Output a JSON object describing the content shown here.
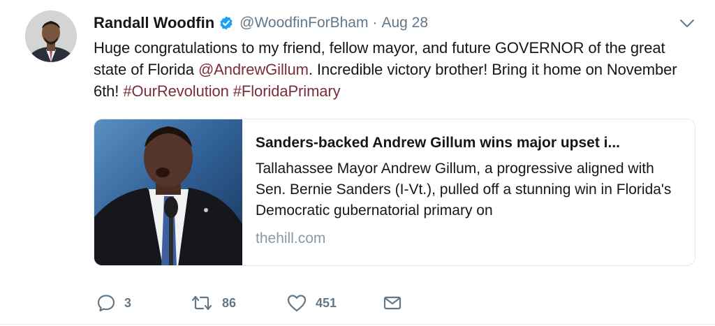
{
  "tweet": {
    "author_name": "Randall Woodfin",
    "author_handle": "@WoodfinForBham",
    "separator": "·",
    "date": "Aug 28",
    "text_parts": {
      "p1": "Huge congratulations to my friend, fellow mayor, and future GOVERNOR of the great state of Florida ",
      "mention": "@AndrewGillum",
      "p2": ". Incredible victory brother! Bring it home on November 6th! ",
      "hashtag1": "#OurRevolution",
      "space": " ",
      "hashtag2": "#FloridaPrimary"
    },
    "card": {
      "title": "Sanders-backed Andrew Gillum wins major upset i...",
      "description": "Tallahassee Mayor Andrew Gillum, a progressive aligned with Sen. Bernie Sanders (I-Vt.), pulled off a stunning win in Florida's Democratic gubernatorial primary on",
      "domain": "thehill.com"
    },
    "actions": {
      "reply_count": "3",
      "retweet_count": "86",
      "like_count": "451"
    }
  },
  "icons": {
    "verified": "verified-badge-icon",
    "caret": "chevron-down-icon",
    "reply": "reply-icon",
    "retweet": "retweet-icon",
    "like": "heart-icon",
    "message": "envelope-icon"
  },
  "colors": {
    "link": "#7b2d3a",
    "verified": "#1da1f2",
    "muted": "#657786",
    "text": "#14171a"
  }
}
